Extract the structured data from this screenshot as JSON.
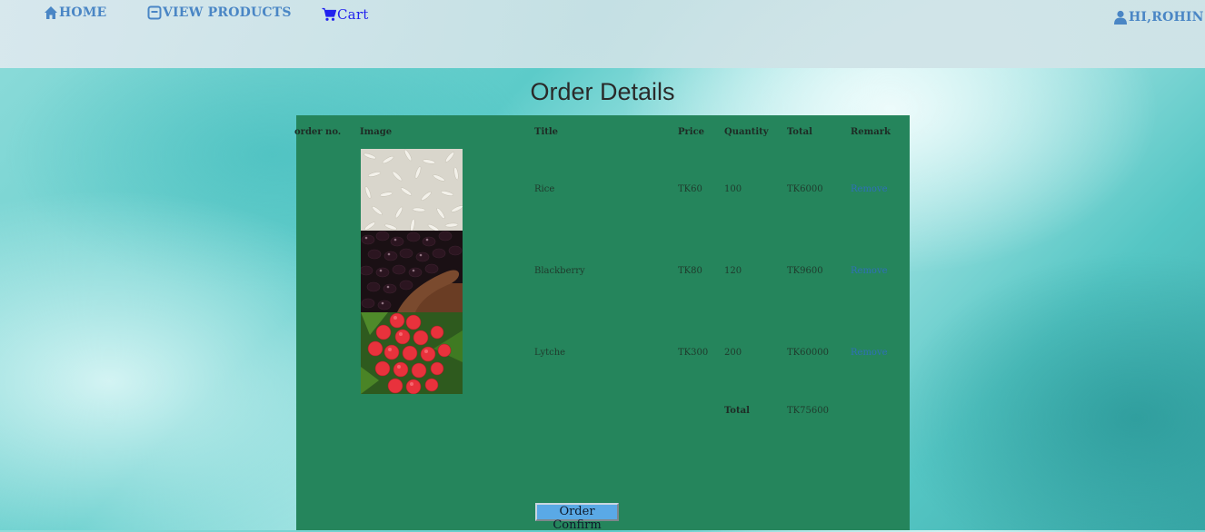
{
  "nav": {
    "home": "HOME",
    "products": "VIEW PRODUCTS",
    "cart": "Cart",
    "user": "HI,ROHIN"
  },
  "page_title": "Order Details",
  "table": {
    "headers": [
      "order no.",
      "Image",
      "Title",
      "Price",
      "Quantity",
      "Total",
      "Remark"
    ],
    "rows": [
      {
        "image": "rice-grains",
        "title": "Rice",
        "price": "TK60",
        "quantity": "100",
        "total": "TK6000",
        "remark": "Remove"
      },
      {
        "image": "blackberries-in-hand",
        "title": "Blackberry",
        "price": "TK80",
        "quantity": "120",
        "total": "TK9600",
        "remark": "Remove"
      },
      {
        "image": "lychee-cluster",
        "title": "Lytche",
        "price": "TK300",
        "quantity": "200",
        "total": "TK60000",
        "remark": "Remove"
      }
    ],
    "total_label": "Total",
    "grand_total": "TK75600"
  },
  "confirm_button": "Order Confirm",
  "colors": {
    "panel": "#25855c",
    "nav_link": "#4a86c5",
    "cart_link": "#2222ee",
    "button": "#5aa9e6"
  }
}
